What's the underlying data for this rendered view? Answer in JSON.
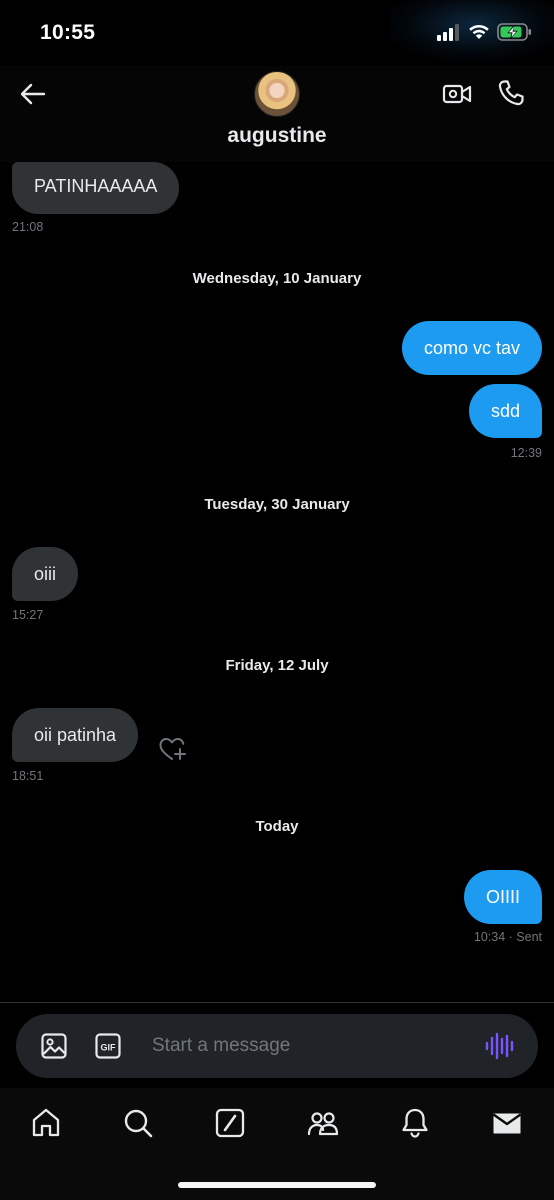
{
  "status_bar": {
    "time": "10:55"
  },
  "header": {
    "contact_name": "augustine",
    "icons": [
      "back-arrow-icon",
      "avatar",
      "video-call-icon",
      "phone-icon"
    ]
  },
  "messages": [
    {
      "side": "in",
      "text": "PATINHAAAAA",
      "time": "21:08"
    },
    {
      "divider": "Wednesday, 10 January"
    },
    {
      "side": "out",
      "text": "como vc tav"
    },
    {
      "side": "out",
      "text": "sdd",
      "time": "12:39"
    },
    {
      "divider": "Tuesday, 30 January"
    },
    {
      "side": "in",
      "text": "oiii",
      "time": "15:27"
    },
    {
      "divider": "Friday, 12 July"
    },
    {
      "side": "in",
      "text": "oii patinha",
      "time": "18:51"
    },
    {
      "divider": "Today"
    },
    {
      "side": "out",
      "text": "OIIII",
      "time": "10:34 · Sent"
    }
  ],
  "composer": {
    "placeholder": "Start a message",
    "icons": [
      "image-icon",
      "gif-icon",
      "voice-icon"
    ],
    "voice_color": "#7856ff"
  },
  "tabbar": {
    "items": [
      "home-icon",
      "search-icon",
      "grok-icon",
      "communities-icon",
      "notifications-icon",
      "messages-icon"
    ]
  },
  "colors": {
    "accent": "#1d9bf0",
    "incoming_bubble": "#2f3336",
    "background": "#000000",
    "muted_text": "#71767b"
  }
}
